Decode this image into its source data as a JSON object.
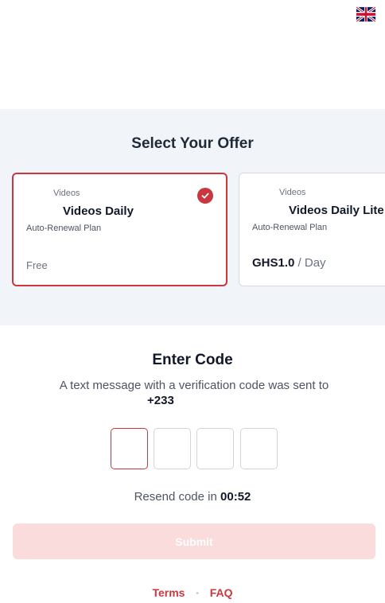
{
  "language": {
    "flag": "uk-flag-icon"
  },
  "offers": {
    "title": "Select Your Offer",
    "cards": [
      {
        "category": "Videos",
        "name": "Videos Daily",
        "plan": "Auto-Renewal Plan",
        "price": "Free",
        "selected": true
      },
      {
        "category": "Videos",
        "name": "Videos Daily Lite",
        "plan": "Auto-Renewal Plan",
        "price_amount": "GHS1.0",
        "price_period": " / Day",
        "selected": false
      }
    ],
    "check_icon": "check-circle-icon"
  },
  "code": {
    "title": "Enter Code",
    "description": "A text message with a verification code was sent to",
    "phone": "+233",
    "resend_label": "Resend code in",
    "timer": "00:52"
  },
  "submit": {
    "label": "Submit"
  },
  "footer": {
    "terms": "Terms",
    "separator": "•",
    "faq": "FAQ"
  },
  "colors": {
    "accent": "#c9383f",
    "submit_disabled": "#fbdcdd",
    "section_bg": "#f1f4f8"
  }
}
